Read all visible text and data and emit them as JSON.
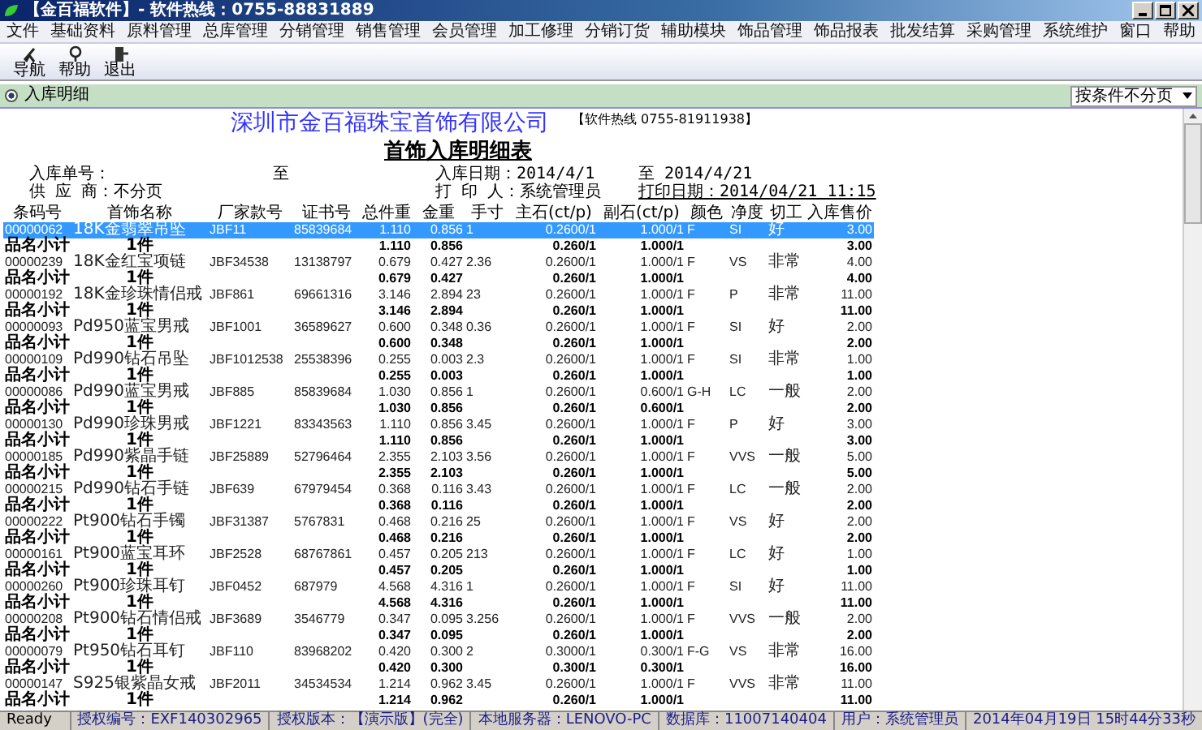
{
  "window": {
    "title": "【金百福软件】- 软件热线：0755-88831889"
  },
  "menu": [
    "文件",
    "基础资料",
    "原料管理",
    "总库管理",
    "分销管理",
    "销售管理",
    "会员管理",
    "加工修理",
    "分销订货",
    "辅助模块",
    "饰品管理",
    "饰品报表",
    "批发结算",
    "采购管理",
    "系统维护",
    "窗口",
    "帮助"
  ],
  "toolbar": [
    {
      "label": "导航",
      "kind": "nav"
    },
    {
      "label": "帮助",
      "kind": "help"
    },
    {
      "label": "退出",
      "kind": "exit"
    }
  ],
  "tab_bar": {
    "title": "入库明细",
    "dropdown": "按条件不分页"
  },
  "report": {
    "company": "深圳市金百福珠宝首饰有限公司",
    "hotline": "【软件热线 0755-81911938】",
    "title": "首饰入库明细表",
    "info": [
      [
        "入库单号：",
        "至",
        "入库日期：2014/4/1",
        "至 2014/4/21"
      ],
      [
        "供 应 商：不分页",
        "打 印 人：系统管理员",
        "打印日期：2014/04/21 11:15"
      ]
    ]
  },
  "table": {
    "columns": [
      "条码号",
      "首饰名称",
      "厂家款号",
      "证书号",
      "总件重",
      "金重",
      "手寸",
      "主石(ct/p)",
      "副石(ct/p)",
      "颜色",
      "净度",
      "切工",
      "入库售价"
    ],
    "items": [
      {
        "selected": true,
        "cells": [
          "00000062",
          "18K金翡翠吊坠",
          "JBF11",
          "85839684",
          "1.110",
          "0.856",
          "1",
          "0.2600/1",
          "1.000/1",
          "F",
          "SI",
          "好",
          "3.00"
        ],
        "subtotal": [
          "品名小计",
          "1件",
          "1.110",
          "0.856",
          "0.260/1",
          "1.000/1",
          "3.00"
        ]
      },
      {
        "selected": false,
        "cells": [
          "00000239",
          "18K金红宝项链",
          "JBF34538",
          "13138797",
          "0.679",
          "0.427",
          "2.36",
          "0.2600/1",
          "1.000/1",
          "F",
          "VS",
          "非常",
          "4.00"
        ],
        "subtotal": [
          "品名小计",
          "1件",
          "0.679",
          "0.427",
          "0.260/1",
          "1.000/1",
          "4.00"
        ]
      },
      {
        "selected": false,
        "cells": [
          "00000192",
          "18K金珍珠情侣戒",
          "JBF861",
          "69661316",
          "3.146",
          "2.894",
          "23",
          "0.2600/1",
          "1.000/1",
          "F",
          "P",
          "非常",
          "11.00"
        ],
        "subtotal": [
          "品名小计",
          "1件",
          "3.146",
          "2.894",
          "0.260/1",
          "1.000/1",
          "11.00"
        ]
      },
      {
        "selected": false,
        "cells": [
          "00000093",
          "Pd950蓝宝男戒",
          "JBF1001",
          "36589627",
          "0.600",
          "0.348",
          "0.36",
          "0.2600/1",
          "1.000/1",
          "F",
          "SI",
          "好",
          "2.00"
        ],
        "subtotal": [
          "品名小计",
          "1件",
          "0.600",
          "0.348",
          "0.260/1",
          "1.000/1",
          "2.00"
        ]
      },
      {
        "selected": false,
        "cells": [
          "00000109",
          "Pd990钻石吊坠",
          "JBF1012538",
          "25538396",
          "0.255",
          "0.003",
          "2.3",
          "0.2600/1",
          "1.000/1",
          "F",
          "SI",
          "非常",
          "1.00"
        ],
        "subtotal": [
          "品名小计",
          "1件",
          "0.255",
          "0.003",
          "0.260/1",
          "1.000/1",
          "1.00"
        ]
      },
      {
        "selected": false,
        "cells": [
          "00000086",
          "Pd990蓝宝男戒",
          "JBF885",
          "85839684",
          "1.030",
          "0.856",
          "1",
          "0.2600/1",
          "0.600/1",
          "G-H",
          "LC",
          "一般",
          "2.00"
        ],
        "subtotal": [
          "品名小计",
          "1件",
          "1.030",
          "0.856",
          "0.260/1",
          "0.600/1",
          "2.00"
        ]
      },
      {
        "selected": false,
        "cells": [
          "00000130",
          "Pd990珍珠男戒",
          "JBF1221",
          "83343563",
          "1.110",
          "0.856",
          "3.45",
          "0.2600/1",
          "1.000/1",
          "F",
          "P",
          "好",
          "3.00"
        ],
        "subtotal": [
          "品名小计",
          "1件",
          "1.110",
          "0.856",
          "0.260/1",
          "1.000/1",
          "3.00"
        ]
      },
      {
        "selected": false,
        "cells": [
          "00000185",
          "Pd990紫晶手链",
          "JBF25889",
          "52796464",
          "2.355",
          "2.103",
          "3.56",
          "0.2600/1",
          "1.000/1",
          "F",
          "VVS",
          "一般",
          "5.00"
        ],
        "subtotal": [
          "品名小计",
          "1件",
          "2.355",
          "2.103",
          "0.260/1",
          "1.000/1",
          "5.00"
        ]
      },
      {
        "selected": false,
        "cells": [
          "00000215",
          "Pd990钻石手链",
          "JBF639",
          "67979454",
          "0.368",
          "0.116",
          "3.43",
          "0.2600/1",
          "1.000/1",
          "F",
          "LC",
          "一般",
          "2.00"
        ],
        "subtotal": [
          "品名小计",
          "1件",
          "0.368",
          "0.116",
          "0.260/1",
          "1.000/1",
          "2.00"
        ]
      },
      {
        "selected": false,
        "cells": [
          "00000222",
          "Pt900钻石手镯",
          "JBF31387",
          "5767831",
          "0.468",
          "0.216",
          "25",
          "0.2600/1",
          "1.000/1",
          "F",
          "VS",
          "好",
          "2.00"
        ],
        "subtotal": [
          "品名小计",
          "1件",
          "0.468",
          "0.216",
          "0.260/1",
          "1.000/1",
          "2.00"
        ]
      },
      {
        "selected": false,
        "cells": [
          "00000161",
          "Pt900蓝宝耳环",
          "JBF2528",
          "68767861",
          "0.457",
          "0.205",
          "213",
          "0.2600/1",
          "1.000/1",
          "F",
          "LC",
          "好",
          "1.00"
        ],
        "subtotal": [
          "品名小计",
          "1件",
          "0.457",
          "0.205",
          "0.260/1",
          "1.000/1",
          "1.00"
        ]
      },
      {
        "selected": false,
        "cells": [
          "00000260",
          "Pt900珍珠耳钉",
          "JBF0452",
          "687979",
          "4.568",
          "4.316",
          "1",
          "0.2600/1",
          "1.000/1",
          "F",
          "SI",
          "好",
          "11.00"
        ],
        "subtotal": [
          "品名小计",
          "1件",
          "4.568",
          "4.316",
          "0.260/1",
          "1.000/1",
          "11.00"
        ]
      },
      {
        "selected": false,
        "cells": [
          "00000208",
          "Pt900钻石情侣戒",
          "JBF3689",
          "3546779",
          "0.347",
          "0.095",
          "3.256",
          "0.2600/1",
          "1.000/1",
          "F",
          "VVS",
          "一般",
          "2.00"
        ],
        "subtotal": [
          "品名小计",
          "1件",
          "0.347",
          "0.095",
          "0.260/1",
          "1.000/1",
          "2.00"
        ]
      },
      {
        "selected": false,
        "cells": [
          "00000079",
          "Pt950钻石耳钉",
          "JBF110",
          "83968202",
          "0.420",
          "0.300",
          "2",
          "0.3000/1",
          "0.300/1",
          "F-G",
          "VS",
          "非常",
          "16.00"
        ],
        "subtotal": [
          "品名小计",
          "1件",
          "0.420",
          "0.300",
          "0.300/1",
          "0.300/1",
          "16.00"
        ]
      },
      {
        "selected": false,
        "cells": [
          "00000147",
          "S925银紫晶女戒",
          "JBF2011",
          "34534534",
          "1.214",
          "0.962",
          "3.45",
          "0.2600/1",
          "1.000/1",
          "F",
          "VVS",
          "非常",
          "11.00"
        ],
        "subtotal": [
          "品名小计",
          "1件",
          "1.214",
          "0.962",
          "0.260/1",
          "1.000/1",
          "11.00"
        ]
      }
    ]
  },
  "status_bar": [
    "Ready",
    "授权编号：EXF140302965",
    "授权版本：【演示版】(完全)",
    "本地服务器：LENOVO-PC",
    "数据库：11007140404",
    "用户：系统管理员",
    "2014年04月19日 15时44分33秒"
  ]
}
